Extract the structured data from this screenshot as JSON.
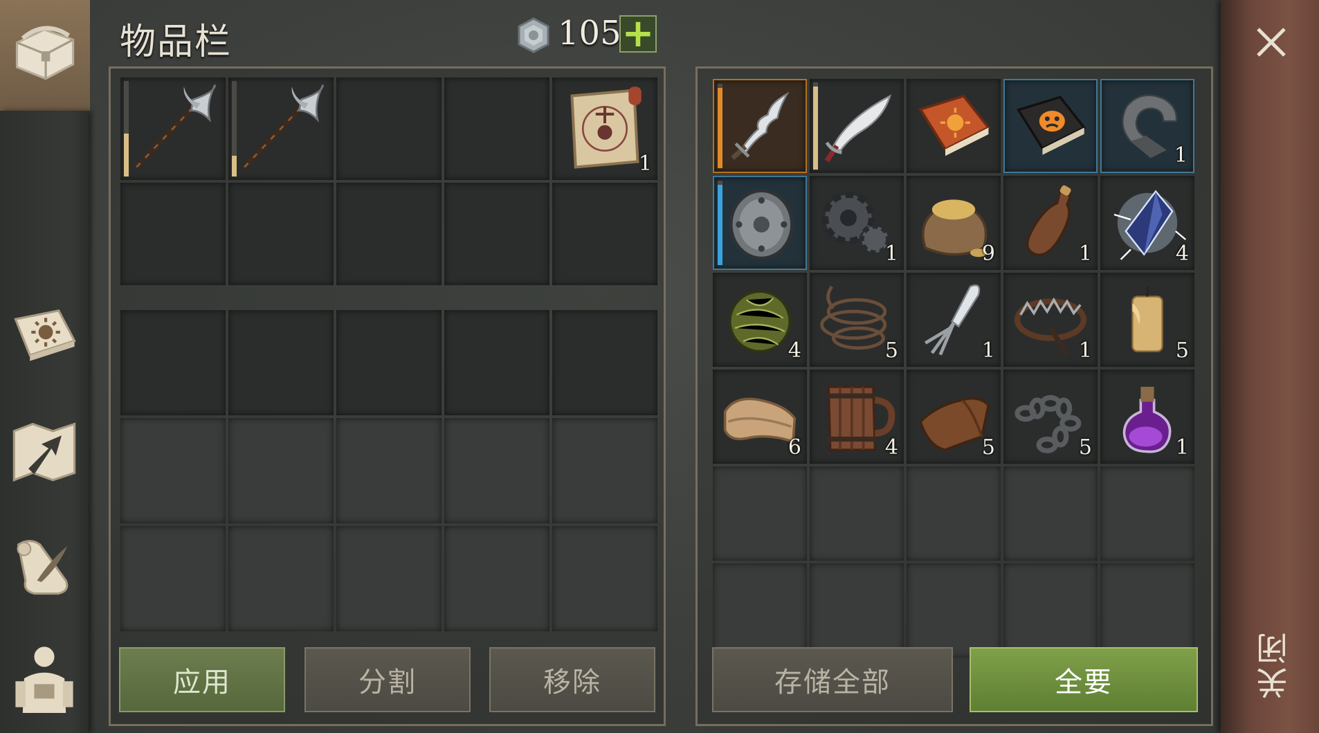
{
  "header": {
    "title": "物品栏",
    "currency_value": "105",
    "add_label": "+",
    "currency_icon": "silver-coin-icon"
  },
  "sidebar": {
    "items": [
      {
        "name": "chest-icon"
      },
      {
        "name": "sun-book-icon"
      },
      {
        "name": "map-arrow-icon"
      },
      {
        "name": "scroll-quill-icon"
      },
      {
        "name": "character-icon"
      }
    ]
  },
  "left_inventory": {
    "top": [
      {
        "icon": "halberd-icon",
        "count": "",
        "durability": 0.45
      },
      {
        "icon": "halberd-icon",
        "count": "",
        "durability": 0.22
      },
      {
        "icon": "",
        "count": ""
      },
      {
        "icon": "",
        "count": ""
      },
      {
        "icon": "map-scroll-icon",
        "count": "1"
      }
    ]
  },
  "right_inventory": {
    "items": [
      {
        "icon": "wavy-sword-icon",
        "count": "",
        "durability": 0.95,
        "rarity": "orange"
      },
      {
        "icon": "scimitar-icon",
        "count": "",
        "durability": 0.95
      },
      {
        "icon": "orange-sun-book-icon",
        "count": ""
      },
      {
        "icon": "dark-mask-book-icon",
        "count": "",
        "rarity": "blue"
      },
      {
        "icon": "iron-hook-icon",
        "count": "1",
        "rarity": "blue"
      },
      {
        "icon": "round-shield-icon",
        "count": "",
        "durability": 0.95,
        "rarity": "blue"
      },
      {
        "icon": "gear-icon",
        "count": "1"
      },
      {
        "icon": "grain-sack-icon",
        "count": "9"
      },
      {
        "icon": "leather-bottle-icon",
        "count": "1"
      },
      {
        "icon": "crystal-icon",
        "count": "4"
      },
      {
        "icon": "herb-ball-icon",
        "count": "4"
      },
      {
        "icon": "rope-icon",
        "count": "5"
      },
      {
        "icon": "meat-fork-icon",
        "count": "1"
      },
      {
        "icon": "bear-trap-icon",
        "count": "1"
      },
      {
        "icon": "candle-icon",
        "count": "5"
      },
      {
        "icon": "cloth-icon",
        "count": "6"
      },
      {
        "icon": "wooden-mug-icon",
        "count": "4"
      },
      {
        "icon": "leather-icon",
        "count": "5"
      },
      {
        "icon": "chain-icon",
        "count": "5"
      },
      {
        "icon": "potion-icon",
        "count": "1"
      }
    ]
  },
  "buttons": {
    "apply": "应用",
    "split": "分割",
    "remove": "移除",
    "store_all": "存储全部",
    "take_all": "全要"
  },
  "close": {
    "label": "关闭"
  },
  "colors": {
    "accent_green": "#7fa04a",
    "rarity_orange": "#e08a2a",
    "rarity_blue": "#3aa3dd"
  }
}
